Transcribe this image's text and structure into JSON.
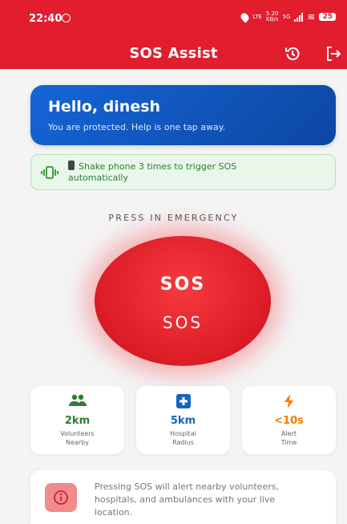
{
  "status": {
    "time": "22:40",
    "lte": "LTE",
    "speed_value": "5.20",
    "speed_unit": "KB/s",
    "net": "5G",
    "battery": "25"
  },
  "header": {
    "title": "SOS Assist",
    "history_icon": "history-icon",
    "logout_icon": "logout-icon"
  },
  "greeting": {
    "title": "Hello, dinesh",
    "subtitle": "You are protected. Help is one tap away."
  },
  "shake": {
    "text_line1": "Shake phone 3 times to trigger SOS",
    "text_line2": "automatically"
  },
  "press_label": "PRESS IN EMERGENCY",
  "sos": {
    "big": "SOS",
    "small": "SOS"
  },
  "stats": [
    {
      "icon": "group-icon",
      "value": "2km",
      "label1": "Volunteers",
      "label2": "Nearby",
      "color": "#2e7d32"
    },
    {
      "icon": "hospital-icon",
      "value": "5km",
      "label1": "Hospital",
      "label2": "Radius",
      "color": "#1565c0"
    },
    {
      "icon": "bolt-icon",
      "value": "<10s",
      "label1": "Alert",
      "label2": "Time",
      "color": "#f57c00"
    }
  ],
  "info": {
    "line1": "Pressing SOS will alert nearby volunteers,",
    "line2": "hospitals, and ambulances with your live",
    "line3": "location."
  },
  "colors": {
    "primary": "#e11d2e",
    "card_blue": "#1565d8",
    "green": "#2e7d32",
    "orange": "#f57c00"
  }
}
